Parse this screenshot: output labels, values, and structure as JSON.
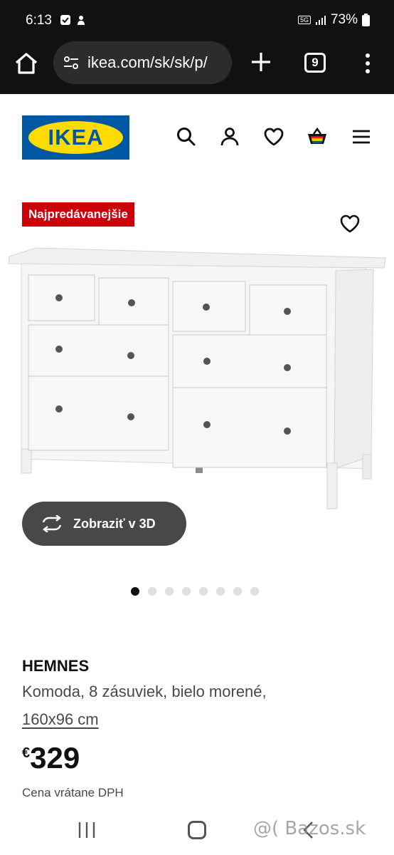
{
  "status_bar": {
    "time": "6:13",
    "network": "5G",
    "battery": "73%"
  },
  "browser": {
    "url": "ikea.com/sk/sk/p/",
    "tab_count": "9"
  },
  "header": {
    "logo_text": "IKEA",
    "icons": [
      "search-icon",
      "account-icon",
      "favorites-icon",
      "cart-icon",
      "menu-icon"
    ]
  },
  "product": {
    "badge": "Najpredávanejšie",
    "view_3d_label": "Zobraziť v 3D",
    "image_count": 8,
    "active_image": 1,
    "name": "HEMNES",
    "description": "Komoda, 8 zásuviek, bielo morené,",
    "size": "160x96 cm",
    "currency": "€",
    "price": "329",
    "vat_note": "Cena vrátane DPH"
  },
  "watermark": "@( Bazos.sk",
  "colors": {
    "brand_blue": "#0058a3",
    "brand_yellow": "#ffdb00",
    "badge_red": "#cc0008",
    "button_dark": "#484848"
  }
}
